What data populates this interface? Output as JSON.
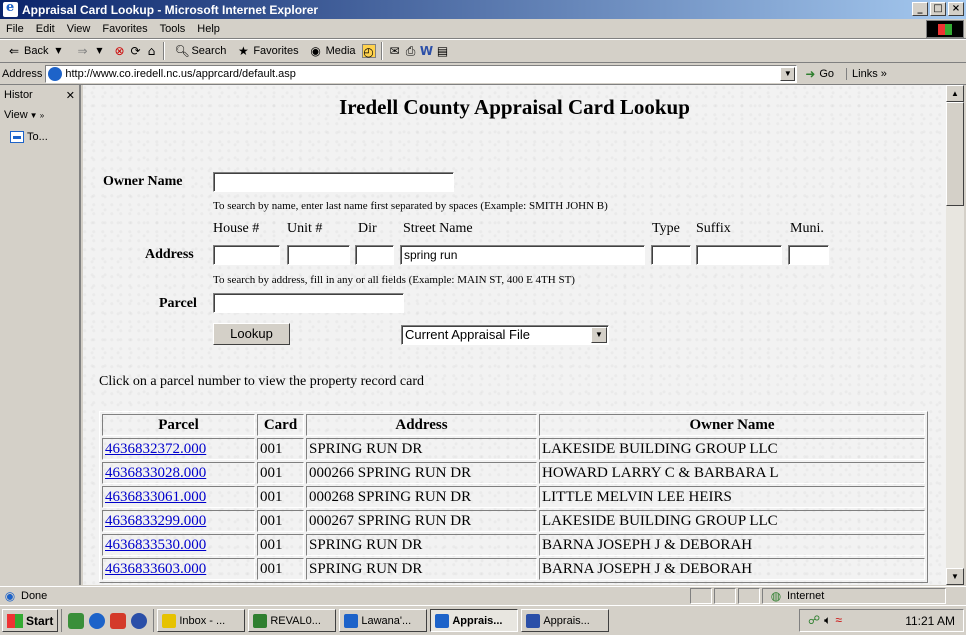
{
  "window": {
    "title": "Appraisal Card Lookup - Microsoft Internet Explorer",
    "controls": [
      "_",
      "□",
      "×"
    ]
  },
  "menu": [
    "File",
    "Edit",
    "View",
    "Favorites",
    "Tools",
    "Help"
  ],
  "toolbar": {
    "back": "Back",
    "search": "Search",
    "favorites": "Favorites",
    "media": "Media"
  },
  "address": {
    "label": "Address",
    "url": "http://www.co.iredell.nc.us/apprcard/default.asp",
    "go": "Go",
    "links": "Links"
  },
  "sidebar": {
    "title": "Histor",
    "view": "View",
    "item": "To..."
  },
  "page": {
    "title": "Iredell County Appraisal Card Lookup",
    "owner_name_label": "Owner Name",
    "owner_name_value": "",
    "owner_hint": "To search by name, enter last name first separated by spaces (Example: SMITH JOHN B)",
    "address_label": "Address",
    "col_house": "House #",
    "col_unit": "Unit #",
    "col_dir": "Dir",
    "col_street": "Street Name",
    "col_type": "Type",
    "col_suffix": "Suffix",
    "col_muni": "Muni.",
    "street_value": "spring run",
    "address_hint": "To search by address, fill in any or all fields (Example: MAIN ST, 400 E 4TH ST)",
    "parcel_label": "Parcel",
    "lookup_button": "Lookup",
    "file_select": "Current Appraisal File",
    "instruction": "Click on a parcel number to view the property record card"
  },
  "results": {
    "headers": [
      "Parcel",
      "Card",
      "Address",
      "Owner Name"
    ],
    "rows": [
      {
        "parcel": "4636832372.000",
        "card": "001",
        "address": "SPRING RUN DR",
        "owner": "LAKESIDE BUILDING GROUP LLC"
      },
      {
        "parcel": "4636833028.000",
        "card": "001",
        "address": "000266 SPRING RUN DR",
        "owner": "HOWARD LARRY C & BARBARA L"
      },
      {
        "parcel": "4636833061.000",
        "card": "001",
        "address": "000268 SPRING RUN DR",
        "owner": "LITTLE MELVIN LEE HEIRS"
      },
      {
        "parcel": "4636833299.000",
        "card": "001",
        "address": "000267 SPRING RUN DR",
        "owner": "LAKESIDE BUILDING GROUP LLC"
      },
      {
        "parcel": "4636833530.000",
        "card": "001",
        "address": "SPRING RUN DR",
        "owner": "BARNA JOSEPH J & DEBORAH"
      },
      {
        "parcel": "4636833603.000",
        "card": "001",
        "address": "SPRING RUN DR",
        "owner": "BARNA JOSEPH J & DEBORAH"
      }
    ]
  },
  "status": {
    "text": "Done",
    "zone": "Internet"
  },
  "taskbar": {
    "start": "Start",
    "tasks": [
      {
        "label": "Inbox - ...",
        "color": "#e6c200",
        "active": false
      },
      {
        "label": "REVAL0...",
        "color": "#2f7f2f",
        "active": false
      },
      {
        "label": "Lawana'...",
        "color": "#1d63c9",
        "active": false
      },
      {
        "label": "Apprais...",
        "color": "#1d63c9",
        "active": true
      },
      {
        "label": "Apprais...",
        "color": "#2b4fa8",
        "active": false
      }
    ],
    "clock": "11:21 AM"
  }
}
